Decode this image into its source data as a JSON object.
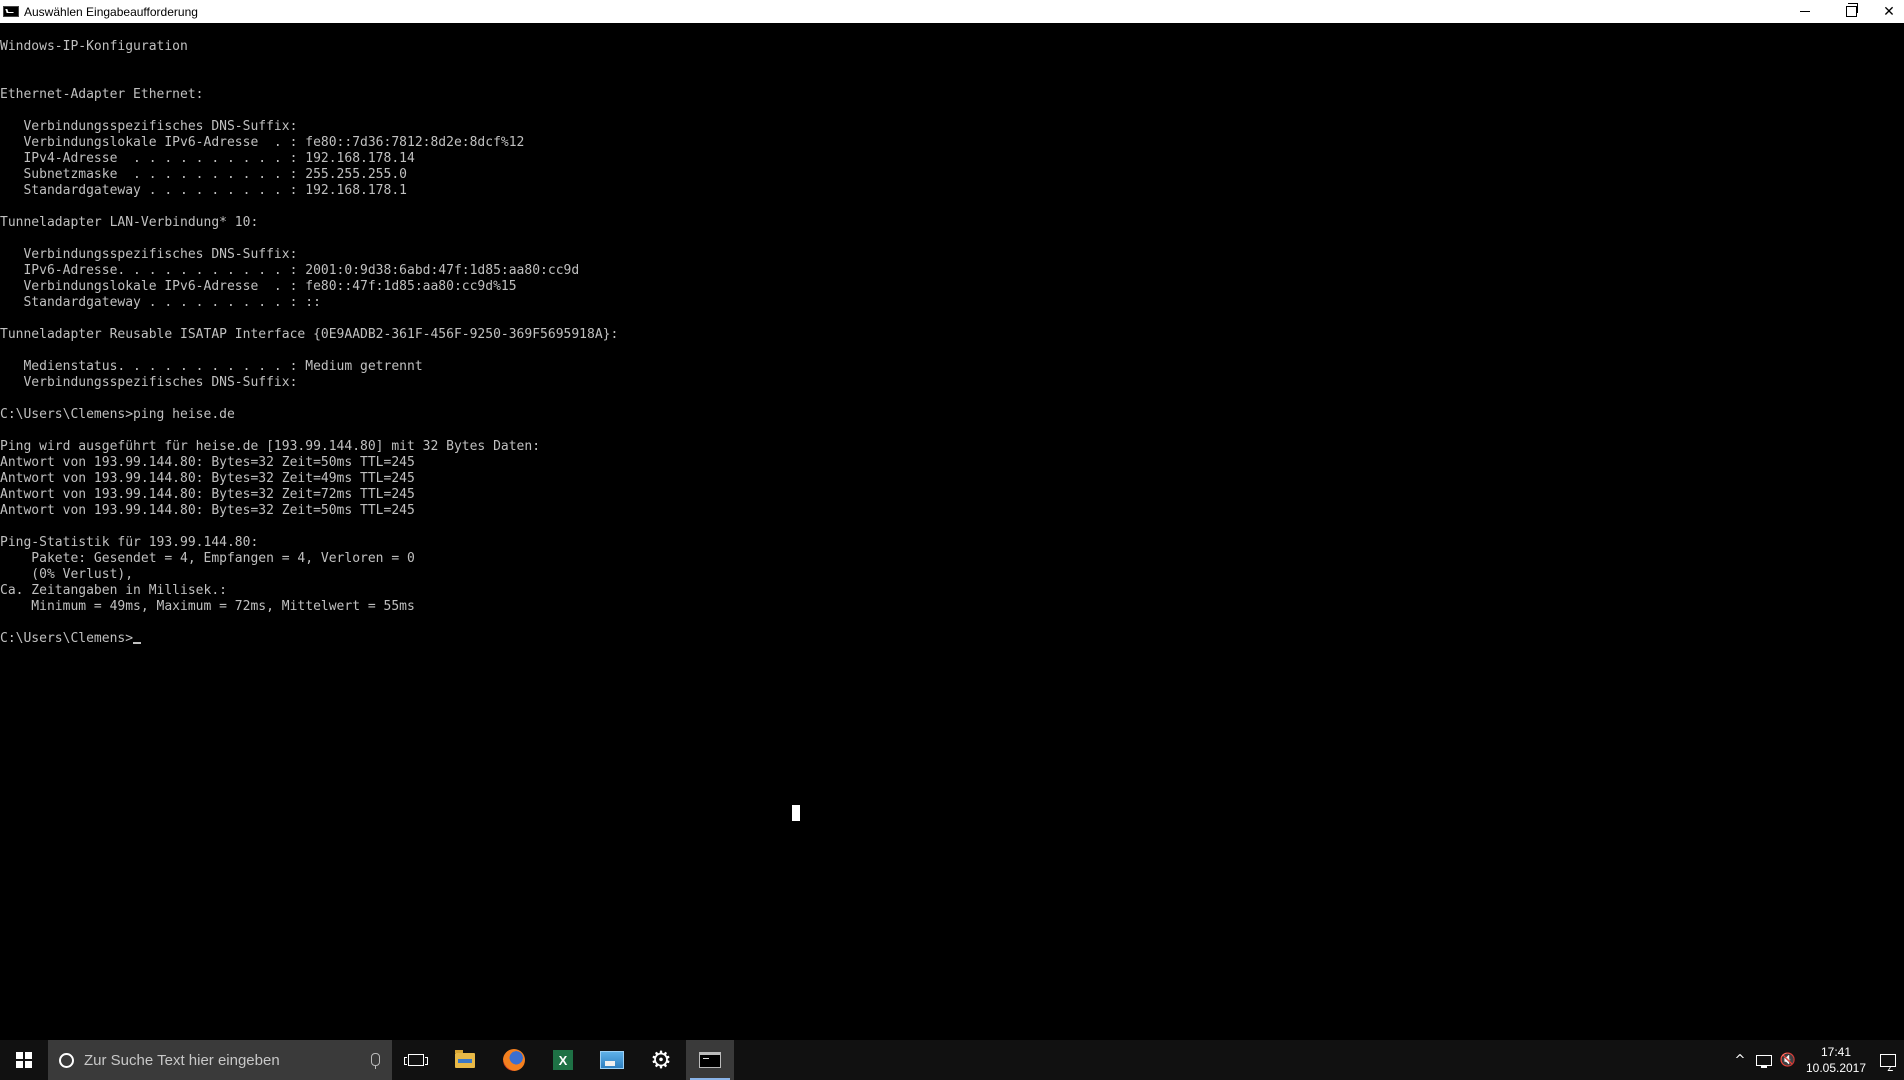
{
  "window": {
    "title": "Auswählen Eingabeaufforderung",
    "icon": "cmd-icon",
    "controls": {
      "minimize": "minimize-icon",
      "restore": "restore-icon",
      "close": "✕"
    }
  },
  "console": {
    "lines": [
      "Windows-IP-Konfiguration",
      "",
      "",
      "Ethernet-Adapter Ethernet:",
      "",
      "   Verbindungsspezifisches DNS-Suffix:",
      "   Verbindungslokale IPv6-Adresse  . : fe80::7d36:7812:8d2e:8dcf%12",
      "   IPv4-Adresse  . . . . . . . . . . : 192.168.178.14",
      "   Subnetzmaske  . . . . . . . . . . : 255.255.255.0",
      "   Standardgateway . . . . . . . . . : 192.168.178.1",
      "",
      "Tunneladapter LAN-Verbindung* 10:",
      "",
      "   Verbindungsspezifisches DNS-Suffix:",
      "   IPv6-Adresse. . . . . . . . . . . : 2001:0:9d38:6abd:47f:1d85:aa80:cc9d",
      "   Verbindungslokale IPv6-Adresse  . : fe80::47f:1d85:aa80:cc9d%15",
      "   Standardgateway . . . . . . . . . : ::",
      "",
      "Tunneladapter Reusable ISATAP Interface {0E9AADB2-361F-456F-9250-369F5695918A}:",
      "",
      "   Medienstatus. . . . . . . . . . . : Medium getrennt",
      "   Verbindungsspezifisches DNS-Suffix:",
      "",
      "C:\\Users\\Clemens>ping heise.de",
      "",
      "Ping wird ausgeführt für heise.de [193.99.144.80] mit 32 Bytes Daten:",
      "Antwort von 193.99.144.80: Bytes=32 Zeit=50ms TTL=245",
      "Antwort von 193.99.144.80: Bytes=32 Zeit=49ms TTL=245",
      "Antwort von 193.99.144.80: Bytes=32 Zeit=72ms TTL=245",
      "Antwort von 193.99.144.80: Bytes=32 Zeit=50ms TTL=245",
      "",
      "Ping-Statistik für 193.99.144.80:",
      "    Pakete: Gesendet = 4, Empfangen = 4, Verloren = 0",
      "    (0% Verlust),",
      "Ca. Zeitangaben in Millisek.:",
      "    Minimum = 49ms, Maximum = 72ms, Mittelwert = 55ms",
      ""
    ],
    "prompt": "C:\\Users\\Clemens>",
    "text_color": "#c0c0c0",
    "background_color": "#000000"
  },
  "taskbar": {
    "search_placeholder": "Zur Suche Text hier eingeben",
    "apps": [
      {
        "name": "task-view",
        "icon": "task-view-icon"
      },
      {
        "name": "file-explorer",
        "icon": "folder-icon"
      },
      {
        "name": "firefox",
        "icon": "firefox-icon"
      },
      {
        "name": "excel",
        "icon": "excel-icon",
        "glyph": "X"
      },
      {
        "name": "photos",
        "icon": "photos-icon"
      },
      {
        "name": "settings",
        "icon": "gear-icon",
        "glyph": "⚙"
      },
      {
        "name": "command-prompt",
        "icon": "cmd-icon",
        "active": true
      }
    ],
    "tray": {
      "chevron": "^",
      "volume_glyph": "🔇",
      "time": "17:41",
      "date": "10.05.2017"
    }
  }
}
